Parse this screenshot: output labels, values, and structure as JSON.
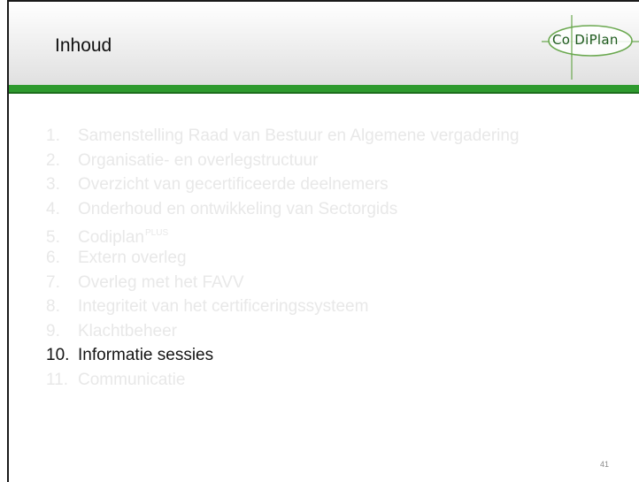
{
  "slide": {
    "title": "Inhoud",
    "page_number": "41",
    "accent_color": "#2e9a2e"
  },
  "logo": {
    "text_left": "Co",
    "text_right": "DiPlan",
    "icon": "codiplan-logo-icon"
  },
  "toc": {
    "items": [
      {
        "num": "1.",
        "label": "Samenstelling Raad van Bestuur en Algemene vergadering",
        "active": false
      },
      {
        "num": "2.",
        "label": "Organisatie- en overlegstructuur",
        "active": false
      },
      {
        "num": "3.",
        "label": "Overzicht van gecertificeerde deelnemers",
        "active": false
      },
      {
        "num": "4.",
        "label": "Onderhoud en ontwikkeling van Sectorgids",
        "active": false
      },
      {
        "num": "5.",
        "label": "Codiplan",
        "sup": "PLUS",
        "active": false
      },
      {
        "num": "6.",
        "label": "Extern overleg",
        "active": false
      },
      {
        "num": "7.",
        "label": "Overleg met het FAVV",
        "active": false
      },
      {
        "num": "8.",
        "label": "Integriteit van het certificeringssysteem",
        "active": false
      },
      {
        "num": "9.",
        "label": "Klachtbeheer",
        "active": false
      },
      {
        "num": "10.",
        "label": "Informatie sessies",
        "active": true
      },
      {
        "num": "11.",
        "label": "Communicatie",
        "active": false
      }
    ]
  }
}
